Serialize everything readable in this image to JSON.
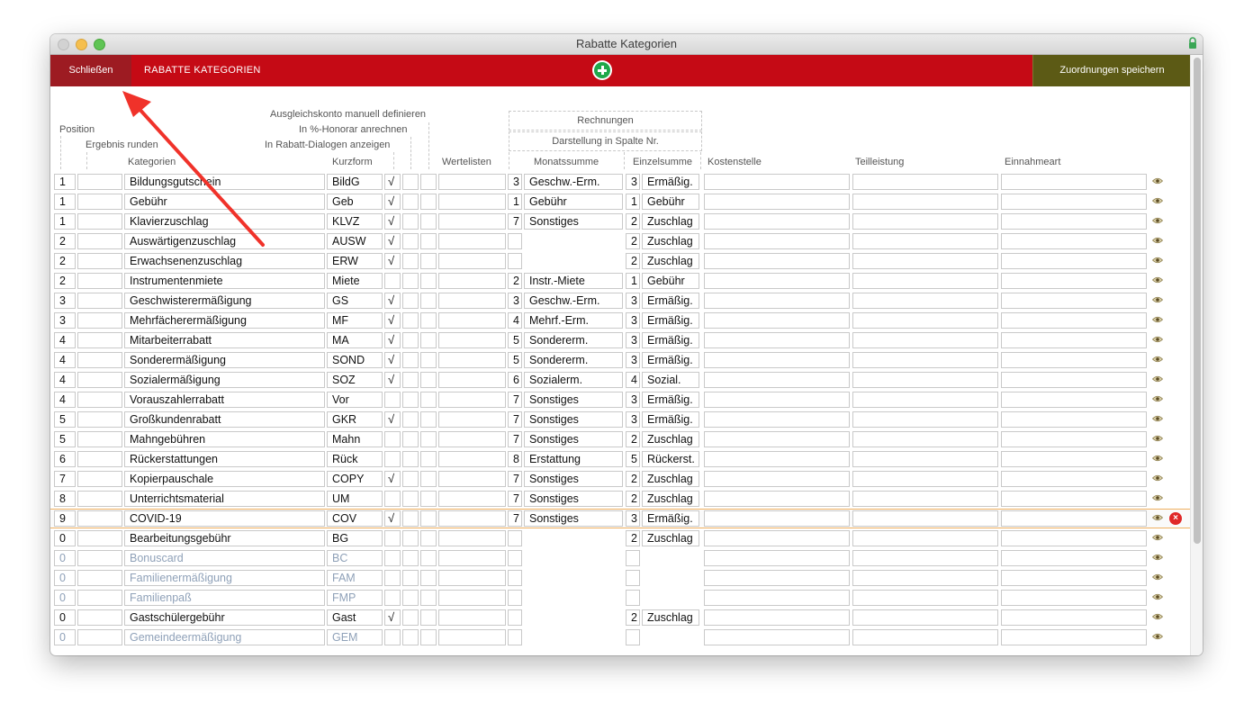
{
  "window": {
    "title": "Rabatte Kategorien"
  },
  "toolbar": {
    "close_label": "Schließen",
    "title": "RABATTE KATEGORIEN",
    "save_label": "Zuordnungen speichern"
  },
  "headers": {
    "position": "Position",
    "ergebnis": "Ergebnis runden",
    "kategorien": "Kategorien",
    "kurzform": "Kurzform",
    "ausgleich": "Ausgleichskonto manuell definieren",
    "honorar": "In %-Honorar anrechnen",
    "dialoge": "In Rabatt-Dialogen anzeigen",
    "wertelisten": "Wertelisten",
    "rechnungen": "Rechnungen",
    "darstellung": "Darstellung in Spalte Nr.",
    "monatssumme": "Monatssumme",
    "einzelsumme": "Einzelsumme",
    "kostenstelle": "Kostenstelle",
    "teilleistung": "Teilleistung",
    "einnahmeart": "Einnahmeart"
  },
  "rows": [
    {
      "pos": "1",
      "kat": "Bildungsgutschein",
      "kurz": "BildG",
      "chk": "√",
      "mn": "3",
      "mt": "Geschw.-Erm.",
      "en": "3",
      "et": "Ermäßig."
    },
    {
      "pos": "1",
      "kat": "Gebühr",
      "kurz": "Geb",
      "chk": "√",
      "mn": "1",
      "mt": "Gebühr",
      "en": "1",
      "et": "Gebühr"
    },
    {
      "pos": "1",
      "kat": "Klavierzuschlag",
      "kurz": "KLVZ",
      "chk": "√",
      "mn": "7",
      "mt": "Sonstiges",
      "en": "2",
      "et": "Zuschlag"
    },
    {
      "pos": "2",
      "kat": "Auswärtigenzuschlag",
      "kurz": "AUSW",
      "chk": "√",
      "mn": "",
      "mt": "",
      "en": "2",
      "et": "Zuschlag",
      "mbox": "num"
    },
    {
      "pos": "2",
      "kat": "Erwachsenenzuschlag",
      "kurz": "ERW",
      "chk": "√",
      "mn": "",
      "mt": "",
      "en": "2",
      "et": "Zuschlag",
      "mbox": "num"
    },
    {
      "pos": "2",
      "kat": "Instrumentenmiete",
      "kurz": "Miete",
      "chk": "",
      "mn": "2",
      "mt": "Instr.-Miete",
      "en": "1",
      "et": "Gebühr"
    },
    {
      "pos": "3",
      "kat": "Geschwisterermäßigung",
      "kurz": "GS",
      "chk": "√",
      "mn": "3",
      "mt": "Geschw.-Erm.",
      "en": "3",
      "et": "Ermäßig."
    },
    {
      "pos": "3",
      "kat": "Mehrfächerermäßigung",
      "kurz": "MF",
      "chk": "√",
      "mn": "4",
      "mt": "Mehrf.-Erm.",
      "en": "3",
      "et": "Ermäßig."
    },
    {
      "pos": "4",
      "kat": "Mitarbeiterrabatt",
      "kurz": "MA",
      "chk": "√",
      "mn": "5",
      "mt": "Sondererm.",
      "en": "3",
      "et": "Ermäßig."
    },
    {
      "pos": "4",
      "kat": "Sonderermäßigung",
      "kurz": "SOND",
      "chk": "√",
      "mn": "5",
      "mt": "Sondererm.",
      "en": "3",
      "et": "Ermäßig."
    },
    {
      "pos": "4",
      "kat": "Sozialermäßigung",
      "kurz": "SOZ",
      "chk": "√",
      "mn": "6",
      "mt": "Sozialerm.",
      "en": "4",
      "et": "Sozial."
    },
    {
      "pos": "4",
      "kat": "Vorauszahlerrabatt",
      "kurz": "Vor",
      "chk": "",
      "mn": "7",
      "mt": "Sonstiges",
      "en": "3",
      "et": "Ermäßig."
    },
    {
      "pos": "5",
      "kat": "Großkundenrabatt",
      "kurz": "GKR",
      "chk": "√",
      "mn": "7",
      "mt": "Sonstiges",
      "en": "3",
      "et": "Ermäßig."
    },
    {
      "pos": "5",
      "kat": "Mahngebühren",
      "kurz": "Mahn",
      "chk": "",
      "mn": "7",
      "mt": "Sonstiges",
      "en": "2",
      "et": "Zuschlag"
    },
    {
      "pos": "6",
      "kat": "Rückerstattungen",
      "kurz": "Rück",
      "chk": "",
      "mn": "8",
      "mt": "Erstattung",
      "en": "5",
      "et": "Rückerst."
    },
    {
      "pos": "7",
      "kat": "Kopierpauschale",
      "kurz": "COPY",
      "chk": "√",
      "mn": "7",
      "mt": "Sonstiges",
      "en": "2",
      "et": "Zuschlag"
    },
    {
      "pos": "8",
      "kat": "Unterrichtsmaterial",
      "kurz": "UM",
      "chk": "",
      "mn": "7",
      "mt": "Sonstiges",
      "en": "2",
      "et": "Zuschlag"
    },
    {
      "pos": "9",
      "kat": "COVID-19",
      "kurz": "COV",
      "chk": "√",
      "mn": "7",
      "mt": "Sonstiges",
      "en": "3",
      "et": "Ermäßig.",
      "sel": true
    },
    {
      "pos": "0",
      "kat": "Bearbeitungsgebühr",
      "kurz": "BG",
      "chk": "",
      "mn": "",
      "mt": "",
      "en": "2",
      "et": "Zuschlag",
      "mbox": "num"
    },
    {
      "pos": "0",
      "kat": "Bonuscard",
      "kurz": "BC",
      "chk": "",
      "mn": "",
      "mt": "",
      "en": "",
      "et": "",
      "mbox": "num",
      "ebox": "num",
      "dim": true
    },
    {
      "pos": "0",
      "kat": "Familienermäßigung",
      "kurz": "FAM",
      "chk": "",
      "mn": "",
      "mt": "",
      "en": "",
      "et": "",
      "mbox": "num",
      "ebox": "num",
      "dim": true
    },
    {
      "pos": "0",
      "kat": "Familienpaß",
      "kurz": "FMP",
      "chk": "",
      "mn": "",
      "mt": "",
      "en": "",
      "et": "",
      "mbox": "num",
      "ebox": "num",
      "dim": true
    },
    {
      "pos": "0",
      "kat": "Gastschülergebühr",
      "kurz": "Gast",
      "chk": "√",
      "mn": "",
      "mt": "",
      "en": "2",
      "et": "Zuschlag",
      "mbox": "num"
    },
    {
      "pos": "0",
      "kat": "Gemeindeermäßigung",
      "kurz": "GEM",
      "chk": "",
      "mn": "",
      "mt": "",
      "en": "",
      "et": "",
      "mbox": "num",
      "ebox": "num",
      "dim": true
    }
  ]
}
